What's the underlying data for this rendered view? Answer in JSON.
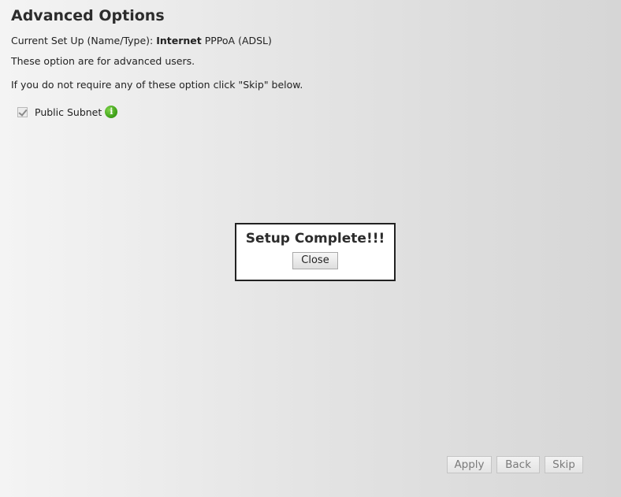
{
  "page": {
    "title": "Advanced Options"
  },
  "setup": {
    "prefix": "Current Set Up (Name/Type): ",
    "name": "Internet",
    "type": " PPPoA (ADSL)"
  },
  "text": {
    "advanced_notice": "These option are for advanced users.",
    "skip_notice": "If you do not require any of these option click \"Skip\" below."
  },
  "options": {
    "public_subnet": {
      "label": "Public Subnet",
      "checked": true,
      "disabled": true,
      "info_icon": "info-icon",
      "info_glyph": "i"
    }
  },
  "modal": {
    "title": "Setup Complete!!!",
    "close_label": "Close"
  },
  "footer": {
    "apply_label": "Apply",
    "back_label": "Back",
    "skip_label": "Skip"
  },
  "colors": {
    "info_green": "#3ea019",
    "modal_border": "#222222"
  }
}
